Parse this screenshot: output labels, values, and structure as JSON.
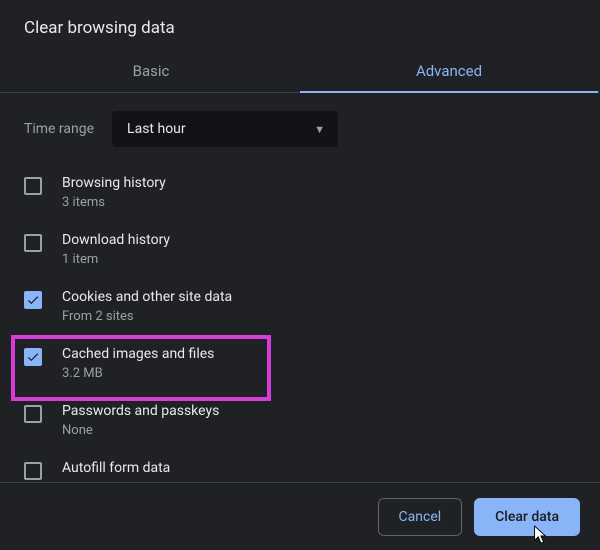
{
  "dialog": {
    "title": "Clear browsing data"
  },
  "tabs": {
    "basic": "Basic",
    "advanced": "Advanced"
  },
  "time": {
    "label": "Time range",
    "selected": "Last hour"
  },
  "items": [
    {
      "label": "Browsing history",
      "sub": "3 items",
      "checked": false
    },
    {
      "label": "Download history",
      "sub": "1 item",
      "checked": false
    },
    {
      "label": "Cookies and other site data",
      "sub": "From 2 sites",
      "checked": true
    },
    {
      "label": "Cached images and files",
      "sub": "3.2 MB",
      "checked": true
    },
    {
      "label": "Passwords and passkeys",
      "sub": "None",
      "checked": false
    },
    {
      "label": "Autofill form data",
      "sub": "",
      "checked": false
    }
  ],
  "buttons": {
    "cancel": "Cancel",
    "clear": "Clear data"
  },
  "highlight_index": 3
}
